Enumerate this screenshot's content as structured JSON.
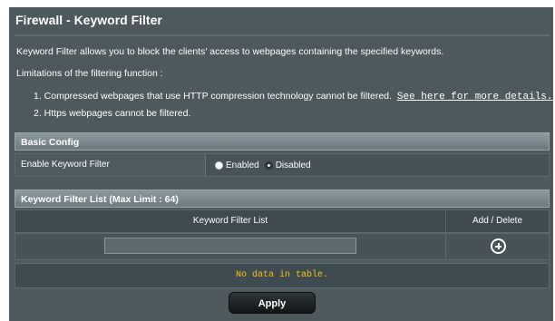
{
  "page": {
    "title": "Firewall - Keyword Filter",
    "description": "Keyword Filter allows you to block the clients' access to webpages containing the specified keywords.",
    "limitations_heading": "Limitations of the filtering function :",
    "limitation_1": "1. Compressed webpages that use HTTP compression technology cannot be filtered.",
    "limitation_1_link": "See here for more details.",
    "limitation_2": "2. Https webpages cannot be filtered."
  },
  "basic_config": {
    "header": "Basic Config",
    "enable_label": "Enable Keyword Filter",
    "options": [
      {
        "label": "Enabled",
        "selected": false
      },
      {
        "label": "Disabled",
        "selected": true
      }
    ]
  },
  "keyword_list": {
    "header": "Keyword Filter List (Max Limit : 64)",
    "col_keyword": "Keyword Filter List",
    "col_action": "Add / Delete",
    "input_value": "",
    "add_icon": "plus-circle-icon",
    "empty_text": "No data in table."
  },
  "actions": {
    "apply_label": "Apply"
  },
  "colors": {
    "panel_bg": "#4d595d",
    "empty_text": "#f3c20d",
    "button_bg": "#1c2123"
  }
}
